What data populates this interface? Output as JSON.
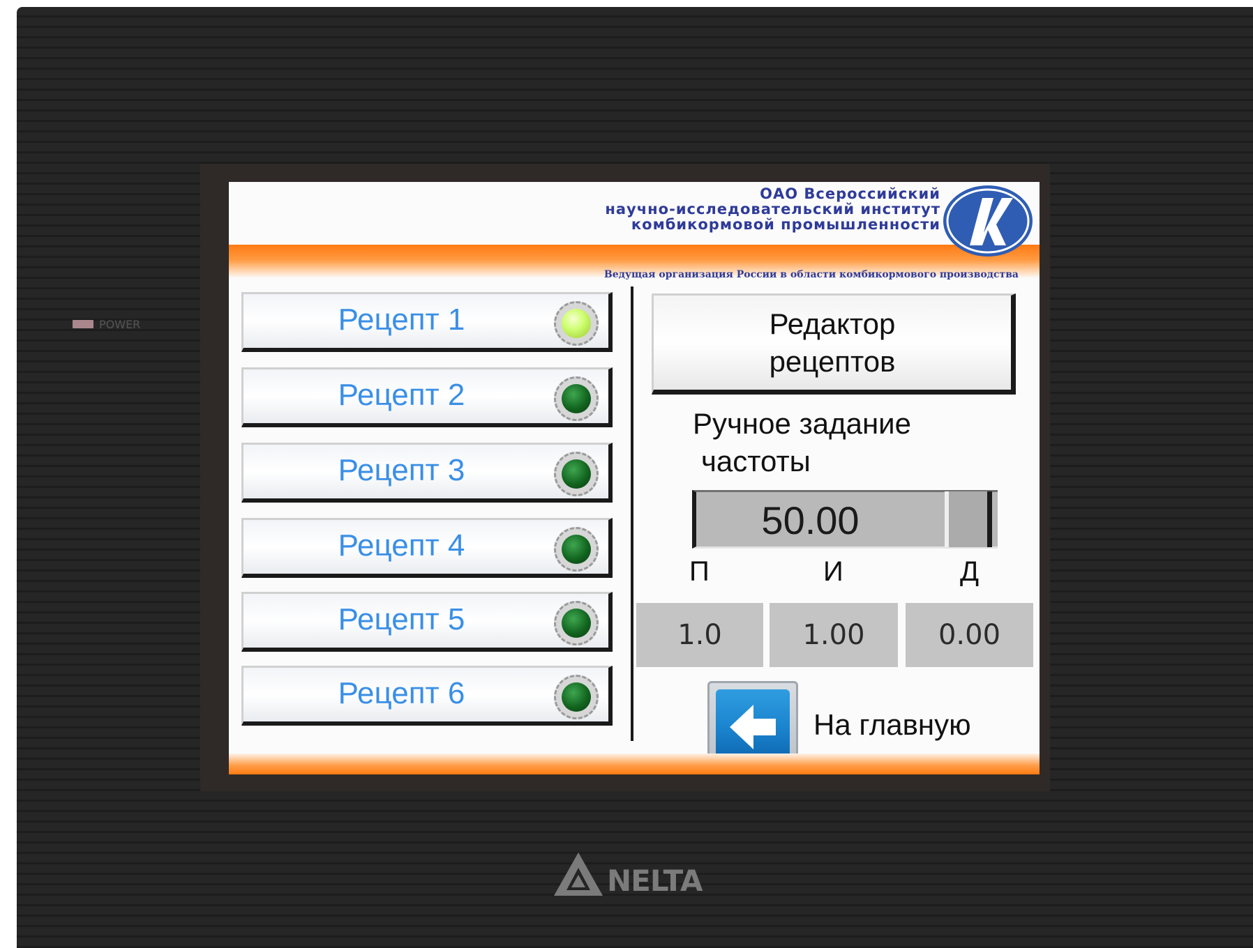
{
  "device": {
    "power_label": "POWER",
    "brand": "NELTA"
  },
  "header": {
    "org_lines": [
      "ОАО Всероссийский",
      "научно-исследовательский институт",
      "комбикормовой промышленности"
    ],
    "slogan": "Ведущая организация России в области комбикормового производства",
    "colors": {
      "band": "#ff7a14",
      "text": "#2f3b99"
    }
  },
  "recipes": [
    {
      "label": "Рецепт 1",
      "lamp": "on"
    },
    {
      "label": "Рецепт 2",
      "lamp": "off"
    },
    {
      "label": "Рецепт 3",
      "lamp": "off"
    },
    {
      "label": "Рецепт 4",
      "lamp": "off"
    },
    {
      "label": "Рецепт 5",
      "lamp": "off"
    },
    {
      "label": "Рецепт 6",
      "lamp": "off"
    }
  ],
  "editor": {
    "line1": "Редактор",
    "line2": "рецептов"
  },
  "manual": {
    "line1": "Ручное задание",
    "line2": "частоты",
    "value": "50.00"
  },
  "pid": {
    "labels": [
      "П",
      "И",
      "Д"
    ],
    "values": [
      "1.0",
      "1.00",
      "0.00"
    ]
  },
  "nav": {
    "home_label": "На главную",
    "home_icon": "arrow-left-icon"
  },
  "colors": {
    "recipe_text": "#3a8fe6",
    "lamp_on": "#cfff73",
    "lamp_off": "#12651f",
    "home_button": "#1b84cf"
  }
}
